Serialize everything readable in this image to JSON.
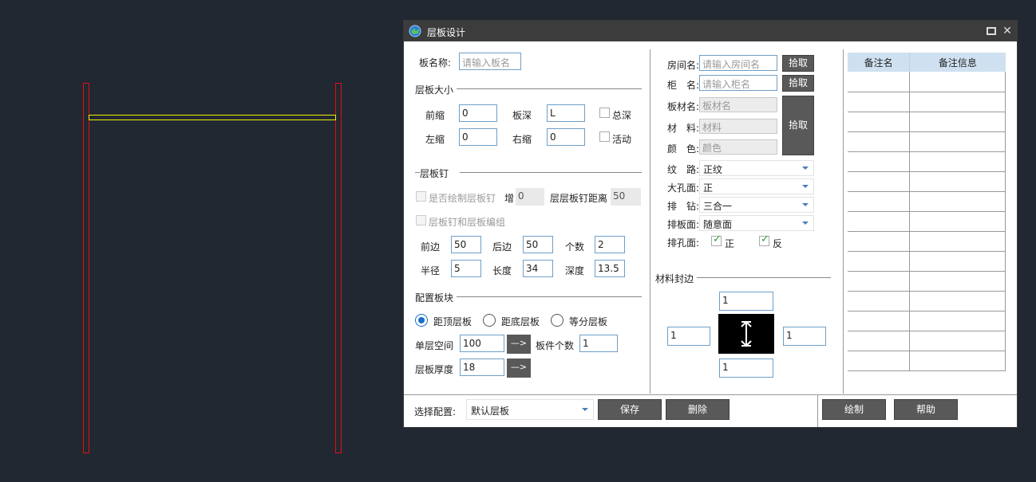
{
  "dialog": {
    "title": "层板设计",
    "restore_icon": "restore-icon",
    "close_icon": "close-icon"
  },
  "left_panel": {
    "board_name_label": "板名称:",
    "board_name_placeholder": "请输入板名",
    "size_section": "层板大小",
    "front_inset_label": "前缩",
    "front_inset_value": "0",
    "depth_label": "板深",
    "depth_value": "L",
    "total_depth_label": "总深",
    "left_inset_label": "左缩",
    "left_inset_value": "0",
    "right_inset_label": "右缩",
    "right_inset_value": "0",
    "movable_label": "活动",
    "nail_section": "层板钉",
    "draw_nail_label": "是否绘制层板钉",
    "increase_label": "增",
    "increase_value": "0",
    "nail_distance_label": "层层板钉距离",
    "nail_distance_value": "50",
    "group_label": "层板钉和层板编组",
    "front_edge_label": "前边",
    "front_edge_value": "50",
    "back_edge_label": "后边",
    "back_edge_value": "50",
    "count_label": "个数",
    "count_value": "2",
    "radius_label": "半径",
    "radius_value": "5",
    "length_label": "长度",
    "length_value": "34",
    "hole_depth_label": "深度",
    "hole_depth_value": "13.5",
    "config_section": "配置板块",
    "radio_top": "距顶层板",
    "radio_bottom": "距底层板",
    "radio_equal": "等分层板",
    "single_space_label": "单层空间",
    "single_space_value": "100",
    "arrow_label": "—>",
    "part_count_label": "板件个数",
    "part_count_value": "1",
    "thickness_label": "层板厚度",
    "thickness_value": "18"
  },
  "middle_panel": {
    "room_label": "房间名:",
    "room_placeholder": "请输入房间名",
    "cabinet_label": "柜　名:",
    "cabinet_placeholder": "请输入柜名",
    "pick_label": "拾取",
    "board_material_label": "板材名:",
    "board_material_placeholder": "板材名",
    "material_label": "材　料:",
    "material_placeholder": "材料",
    "color_label": "颜　色:",
    "color_placeholder": "颜色",
    "grain_label": "纹　路:",
    "grain_value": "正纹",
    "big_hole_label": "大孔面:",
    "big_hole_value": "正",
    "drill_label": "排　钻:",
    "drill_value": "三合一",
    "layout_face_label": "排板面:",
    "layout_face_value": "随意面",
    "hole_face_label": "排孔面:",
    "hole_face_front": "正",
    "hole_face_back": "反",
    "edge_section": "材料封边",
    "edge_top": "1",
    "edge_left": "1",
    "edge_right": "1",
    "edge_bottom": "1"
  },
  "right_panel": {
    "col_name": "备注名",
    "col_info": "备注信息"
  },
  "footer": {
    "config_label": "选择配置:",
    "config_value": "默认层板",
    "save_label": "保存",
    "delete_label": "删除",
    "draw_label": "绘制",
    "help_label": "帮助"
  },
  "colors": {
    "canvas_bg": "#222831",
    "post": "#e01010",
    "shelf": "#f0f000",
    "header_bg": "#cfe1f1",
    "button_bg": "#595959"
  }
}
